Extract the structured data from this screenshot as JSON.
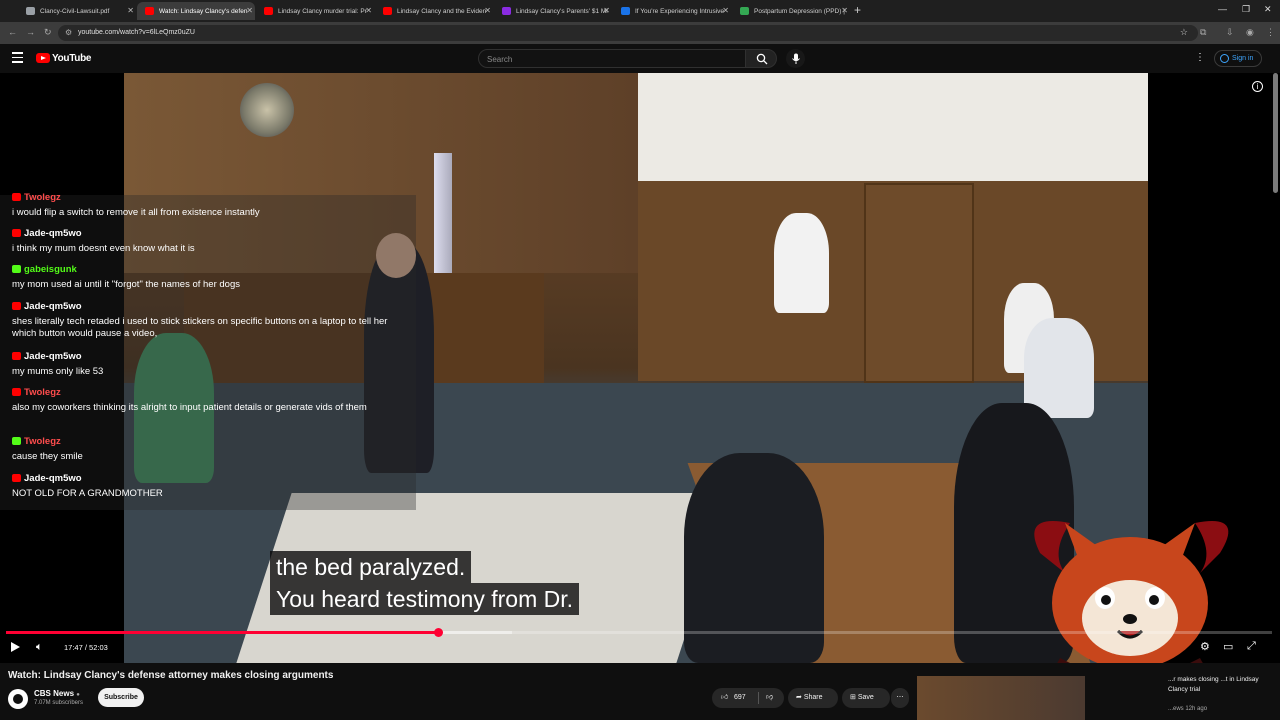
{
  "browser": {
    "tabs": [
      {
        "label": "Clancy-Civil-Lawsuit.pdf",
        "color": "#9aa0a6",
        "active": false
      },
      {
        "label": "Watch: Lindsay Clancy's defen",
        "color": "#ff0000",
        "active": true
      },
      {
        "label": "Lindsay Clancy murder trial: Pr",
        "color": "#ff0000",
        "active": false
      },
      {
        "label": "Lindsay Clancy and the Eviden",
        "color": "#ff0000",
        "active": false
      },
      {
        "label": "Lindsay Clancy's Parents' $1 Mi",
        "color": "#8a2be2",
        "active": false
      },
      {
        "label": "If You're Experiencing Intrusive",
        "color": "#1a73e8",
        "active": false
      },
      {
        "label": "Postpartum Depression (PPD) |",
        "color": "#34a853",
        "active": false
      }
    ],
    "new_tab": "+",
    "url": "youtube.com/watch?v=6lLeQmz0uZU"
  },
  "youtube": {
    "logo_text": "YouTube",
    "search_placeholder": "Search",
    "sign_in": "Sign in"
  },
  "chat": [
    {
      "name": "Twolegz",
      "color": "#ff4d4d",
      "icon": "youtube",
      "text": "i would flip a switch to remove it all from existence instantly"
    },
    {
      "name": "Jade-qm5wo",
      "color": "#ffffff",
      "icon": "youtube",
      "text": "i think my mum doesnt even know what it is"
    },
    {
      "name": "gabeisgunk",
      "color": "#53fc18",
      "icon": "kick",
      "text": "my mom used ai until it \"forgot\" the names of her dogs"
    },
    {
      "name": "Jade-qm5wo",
      "color": "#ffffff",
      "icon": "youtube",
      "text": "shes literally tech retaded i used to stick stickers on specific buttons on a laptop to tell her which button would pause a video,"
    },
    {
      "name": "Jade-qm5wo",
      "color": "#ffffff",
      "icon": "youtube",
      "text": "my mums only like 53"
    },
    {
      "name": "Twolegz",
      "color": "#ff4d4d",
      "icon": "youtube",
      "text": "also my coworkers thinking its alright to input patient details or generate vids of them"
    },
    {
      "name": "Twolegz",
      "color": "#ff4d4d",
      "icon": "kick",
      "text": "cause they smile"
    },
    {
      "name": "Jade-qm5wo",
      "color": "#ffffff",
      "icon": "youtube",
      "text": "NOT OLD FOR A GRANDMOTHER"
    }
  ],
  "captions": [
    "the bed paralyzed.",
    "You heard testimony from Dr."
  ],
  "player": {
    "time": "17:47 / 52:03",
    "progress": 0.3416,
    "buffered": 0.4
  },
  "video": {
    "title": "Watch: Lindsay Clancy's defense attorney makes closing arguments",
    "channel": "CBS News",
    "subscribers": "7.07M subscribers",
    "subscribe_label": "Subscribe",
    "likes": "697",
    "share_label": "Share",
    "save_label": "Save"
  },
  "related": {
    "title": "...r makes closing ...t in Lindsay Clancy trial",
    "meta": "...ews  12h ago"
  }
}
